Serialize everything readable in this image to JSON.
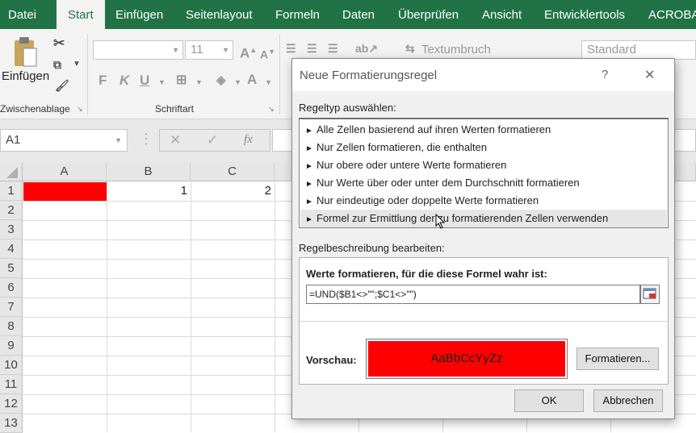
{
  "ribbon_tabs": [
    "Datei",
    "Start",
    "Einfügen",
    "Seitenlayout",
    "Formeln",
    "Daten",
    "Überprüfen",
    "Ansicht",
    "Entwicklertools",
    "ACROBAT"
  ],
  "ribbon": {
    "paste_label": "Einfügen",
    "clipboard_group": "Zwischenablage",
    "font_group": "Schriftart",
    "font_size": "11",
    "bold": "F",
    "italic": "K",
    "underline": "U",
    "wrap_text": "Textumbruch",
    "number_format": "Standard"
  },
  "formula_bar": {
    "name_box": "A1",
    "fx_label": "fx"
  },
  "grid": {
    "columns": [
      "A",
      "B",
      "C"
    ],
    "rows": [
      "1",
      "2",
      "3",
      "4",
      "5",
      "6",
      "7",
      "8",
      "9",
      "10",
      "11",
      "12",
      "13"
    ],
    "cells": {
      "B1": "1",
      "C1": "2"
    },
    "A1_fill": "#ff0000"
  },
  "dialog": {
    "title": "Neue Formatierungsregel",
    "help": "?",
    "close": "✕",
    "rule_type_label": "Regeltyp auswählen:",
    "rule_types": [
      "Alle Zellen basierend auf ihren Werten formatieren",
      "Nur Zellen formatieren, die enthalten",
      "Nur obere oder untere Werte formatieren",
      "Nur Werte über oder unter dem Durchschnitt formatieren",
      "Nur eindeutige oder doppelte Werte formatieren",
      "Formel zur Ermittlung der zu formatierenden Zellen verwenden"
    ],
    "selected_index": 5,
    "rule_desc_label": "Regelbeschreibung bearbeiten:",
    "formula_heading": "Werte formatieren, für die diese Formel wahr ist:",
    "formula_value": "=UND($B1<>\"\";$C1<>\"\")",
    "preview_label": "Vorschau:",
    "preview_text": "AaBbCcYyZz",
    "preview_fill": "#ff0000",
    "format_button": "Formatieren...",
    "ok_button": "OK",
    "cancel_button": "Abbrechen"
  }
}
